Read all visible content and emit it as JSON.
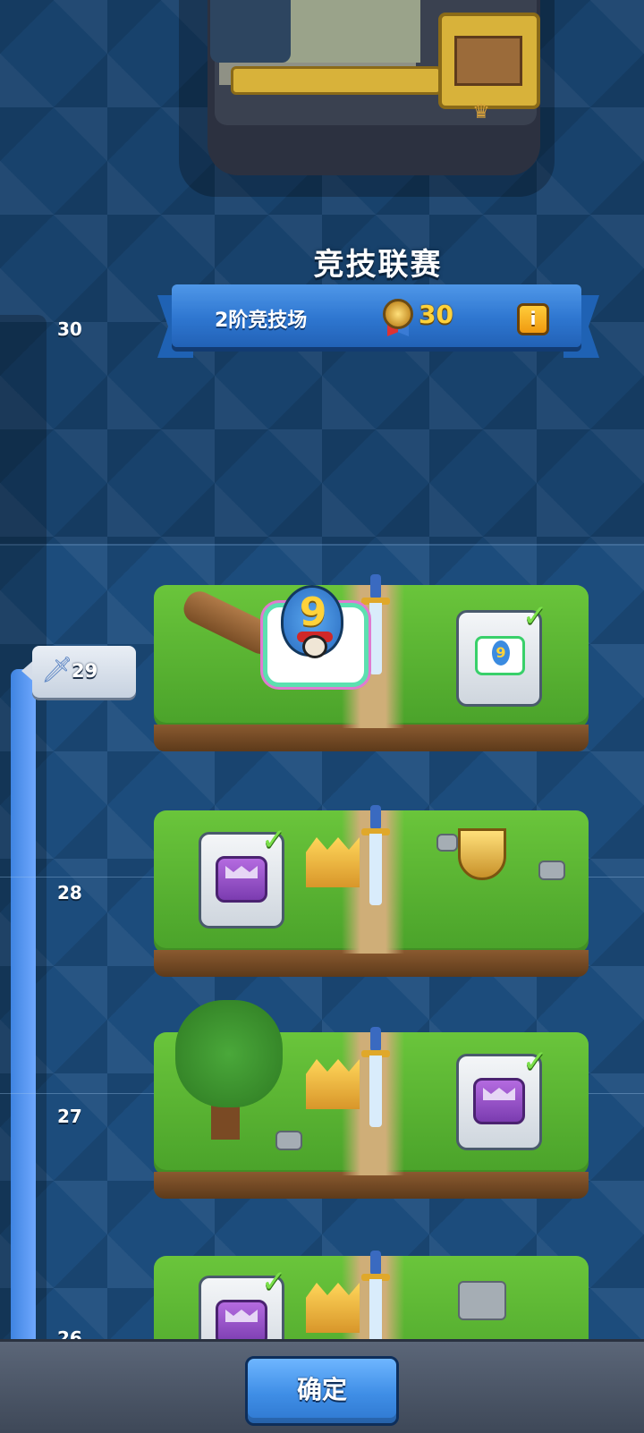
{
  "header": {
    "title": "竞技联赛",
    "arena_label": "2阶竞技场",
    "trophy_count": "30",
    "info_label": "i"
  },
  "progress": {
    "current_value": "29",
    "ticks": [
      "30",
      "28",
      "27",
      "26"
    ]
  },
  "rewards": [
    {
      "level": 29,
      "reward": "emote",
      "claimed": true
    },
    {
      "level": 28,
      "reward": "chest",
      "claimed": true
    },
    {
      "level": 27,
      "reward": "chest",
      "claimed": true
    },
    {
      "level": 26,
      "reward": "chest",
      "claimed": true
    }
  ],
  "icons": {
    "sword": "sword-icon",
    "trophy": "trophy-icon",
    "check": "check-icon"
  },
  "footer": {
    "ok_label": "确定"
  },
  "colors": {
    "background": "#1c4c7c",
    "banner": "#2e76d0",
    "trophy_text": "#ffd23a",
    "button": "#3f8ee6",
    "grass": "#5cb532"
  }
}
